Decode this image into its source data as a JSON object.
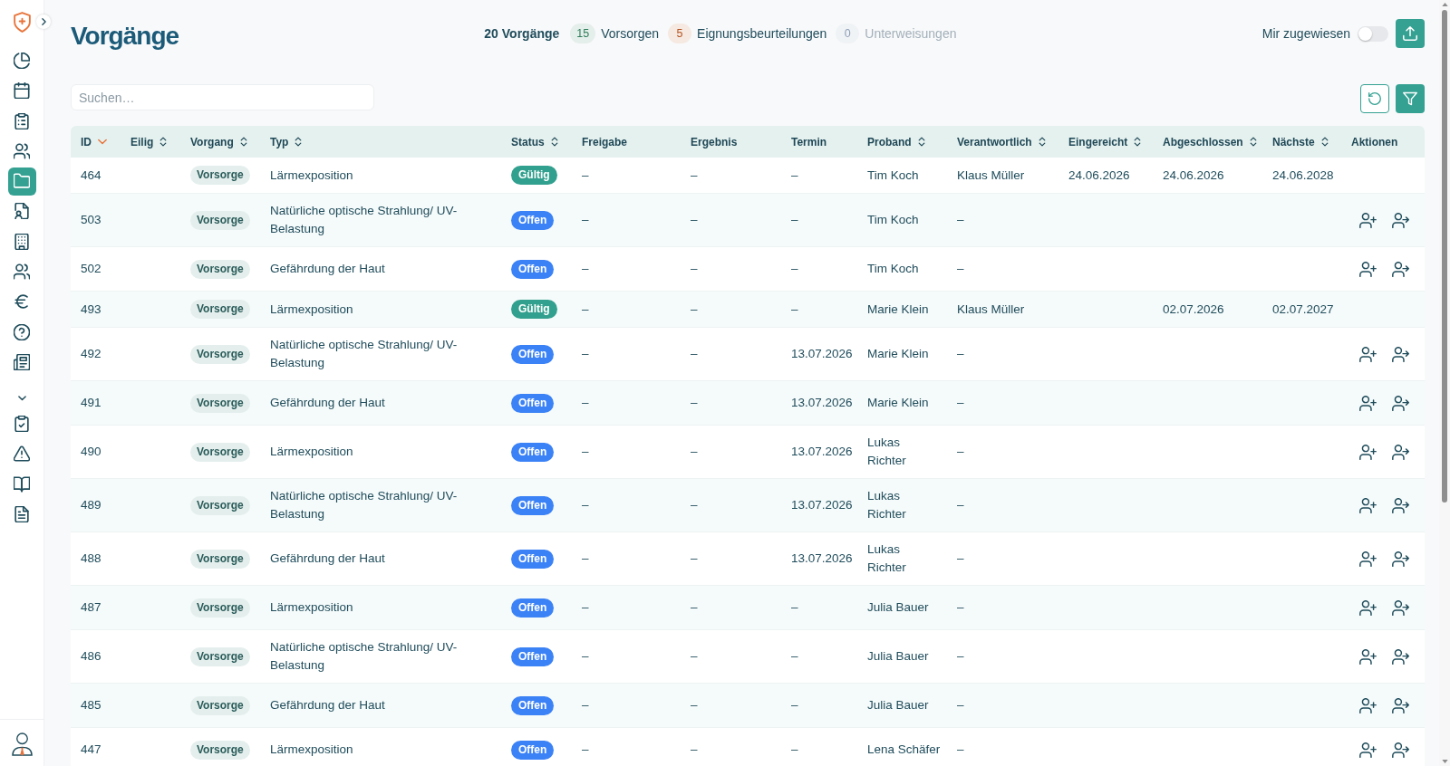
{
  "sidebar": {
    "items": [
      {
        "selected": false
      },
      {
        "selected": false
      },
      {
        "selected": false
      },
      {
        "selected": false
      },
      {
        "selected": true
      },
      {
        "selected": false
      },
      {
        "selected": false
      },
      {
        "selected": false
      },
      {
        "selected": false
      },
      {
        "selected": false
      },
      {
        "selected": false
      }
    ],
    "section": {
      "expanded": true,
      "items": [
        {
          "selected": false
        },
        {
          "selected": false
        },
        {
          "selected": false
        },
        {
          "selected": false
        }
      ]
    }
  },
  "page": {
    "title": "Vorgänge"
  },
  "summary": {
    "total": "20 Vorgänge",
    "counts": [
      {
        "count": "15",
        "label": "Vorsorgen",
        "color": "#2e7d5b",
        "muted": false
      },
      {
        "count": "5",
        "label": "Eignungsbeurteilungen",
        "color": "#b4531f",
        "muted": false
      },
      {
        "count": "0",
        "label": "Unterweisungen",
        "color": "#8fa0b8",
        "muted": true
      }
    ]
  },
  "toggle": {
    "label": "Mir zugewiesen",
    "on": false
  },
  "search": {
    "placeholder": "Suchen…"
  },
  "table": {
    "columns": [
      {
        "label": "ID",
        "sortable": true,
        "sorted": true
      },
      {
        "label": "Eilig",
        "sortable": true,
        "sorted": false
      },
      {
        "label": "Vorgang",
        "sortable": true,
        "sorted": false
      },
      {
        "label": "Typ",
        "sortable": true,
        "sorted": false
      },
      {
        "label": "Status",
        "sortable": true,
        "sorted": false
      },
      {
        "label": "Freigabe",
        "sortable": false,
        "sorted": false
      },
      {
        "label": "Ergebnis",
        "sortable": false,
        "sorted": false
      },
      {
        "label": "Termin",
        "sortable": false,
        "sorted": false
      },
      {
        "label": "Proband",
        "sortable": true,
        "sorted": false
      },
      {
        "label": "Verantwortlich",
        "sortable": true,
        "sorted": false
      },
      {
        "label": "Eingereicht",
        "sortable": true,
        "sorted": false
      },
      {
        "label": "Abgeschlossen",
        "sortable": true,
        "sorted": false
      },
      {
        "label": "Nächste",
        "sortable": true,
        "sorted": false
      },
      {
        "label": "Aktionen",
        "sortable": false,
        "sorted": false
      }
    ],
    "rows": [
      {
        "id": "464",
        "process": "Vorsorge",
        "type": "Lärmexposition",
        "status": {
          "label": "Gültig",
          "color": "#32a08e"
        },
        "release": "–",
        "result": "–",
        "appointment": "–",
        "subject": "Tim Koch",
        "responsible": "Klaus Müller",
        "submitted": "24.06.2026",
        "completed": "24.06.2026",
        "next": "24.06.2028",
        "actions": false
      },
      {
        "id": "503",
        "process": "Vorsorge",
        "type": "Natürliche optische Strahlung/ UV-Belastung",
        "status": {
          "label": "Offen",
          "color": "#3b82f6"
        },
        "release": "–",
        "result": "–",
        "appointment": "–",
        "subject": "Tim Koch",
        "responsible": "–",
        "actions": true
      },
      {
        "id": "502",
        "process": "Vorsorge",
        "type": "Gefährdung der Haut",
        "status": {
          "label": "Offen",
          "color": "#3b82f6"
        },
        "release": "–",
        "result": "–",
        "appointment": "–",
        "subject": "Tim Koch",
        "responsible": "–",
        "actions": true
      },
      {
        "id": "493",
        "process": "Vorsorge",
        "type": "Lärmexposition",
        "status": {
          "label": "Gültig",
          "color": "#32a08e"
        },
        "release": "–",
        "result": "–",
        "appointment": "–",
        "subject": "Marie Klein",
        "responsible": "Klaus Müller",
        "completed": "02.07.2026",
        "next": "02.07.2027",
        "actions": false
      },
      {
        "id": "492",
        "process": "Vorsorge",
        "type": "Natürliche optische Strahlung/ UV-Belastung",
        "status": {
          "label": "Offen",
          "color": "#3b82f6"
        },
        "release": "–",
        "result": "–",
        "appointment": "13.07.2026",
        "subject": "Marie Klein",
        "responsible": "–",
        "actions": true
      },
      {
        "id": "491",
        "process": "Vorsorge",
        "type": "Gefährdung der Haut",
        "status": {
          "label": "Offen",
          "color": "#3b82f6"
        },
        "release": "–",
        "result": "–",
        "appointment": "13.07.2026",
        "subject": "Marie Klein",
        "responsible": "–",
        "actions": true
      },
      {
        "id": "490",
        "process": "Vorsorge",
        "type": "Lärmexposition",
        "status": {
          "label": "Offen",
          "color": "#3b82f6"
        },
        "release": "–",
        "result": "–",
        "appointment": "13.07.2026",
        "subject": "Lukas Richter",
        "responsible": "–",
        "actions": true
      },
      {
        "id": "489",
        "process": "Vorsorge",
        "type": "Natürliche optische Strahlung/ UV-Belastung",
        "status": {
          "label": "Offen",
          "color": "#3b82f6"
        },
        "release": "–",
        "result": "–",
        "appointment": "13.07.2026",
        "subject": "Lukas Richter",
        "responsible": "–",
        "actions": true
      },
      {
        "id": "488",
        "process": "Vorsorge",
        "type": "Gefährdung der Haut",
        "status": {
          "label": "Offen",
          "color": "#3b82f6"
        },
        "release": "–",
        "result": "–",
        "appointment": "13.07.2026",
        "subject": "Lukas Richter",
        "responsible": "–",
        "actions": true
      },
      {
        "id": "487",
        "process": "Vorsorge",
        "type": "Lärmexposition",
        "status": {
          "label": "Offen",
          "color": "#3b82f6"
        },
        "release": "–",
        "result": "–",
        "appointment": "–",
        "subject": "Julia Bauer",
        "responsible": "–",
        "actions": true
      },
      {
        "id": "486",
        "process": "Vorsorge",
        "type": "Natürliche optische Strahlung/ UV-Belastung",
        "status": {
          "label": "Offen",
          "color": "#3b82f6"
        },
        "release": "–",
        "result": "–",
        "appointment": "–",
        "subject": "Julia Bauer",
        "responsible": "–",
        "actions": true
      },
      {
        "id": "485",
        "process": "Vorsorge",
        "type": "Gefährdung der Haut",
        "status": {
          "label": "Offen",
          "color": "#3b82f6"
        },
        "release": "–",
        "result": "–",
        "appointment": "–",
        "subject": "Julia Bauer",
        "responsible": "–",
        "actions": true
      },
      {
        "id": "447",
        "process": "Vorsorge",
        "type": "Lärmexposition",
        "status": {
          "label": "Offen",
          "color": "#3b82f6"
        },
        "release": "–",
        "result": "–",
        "appointment": "–",
        "subject": "Lena Schäfer",
        "responsible": "–",
        "actions": true
      }
    ]
  }
}
